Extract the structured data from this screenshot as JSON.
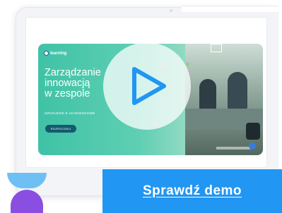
{
  "banner": {
    "logo_text": "learning",
    "headline": "Zarządzanie\ninnowacją\nw zespole",
    "subline": "SZKOLENIE E-LEARNINGOWE",
    "start_button": "ROZPOCZNIJ"
  },
  "video": {
    "play_icon": "play-icon",
    "accent_color": "#2196f3"
  },
  "cta": {
    "demo_label": "Sprawdź demo",
    "color": "#2196f3"
  },
  "decor": {
    "top_shape_color": "#6ec0f4",
    "bottom_shape_color": "#8a4fe0"
  }
}
